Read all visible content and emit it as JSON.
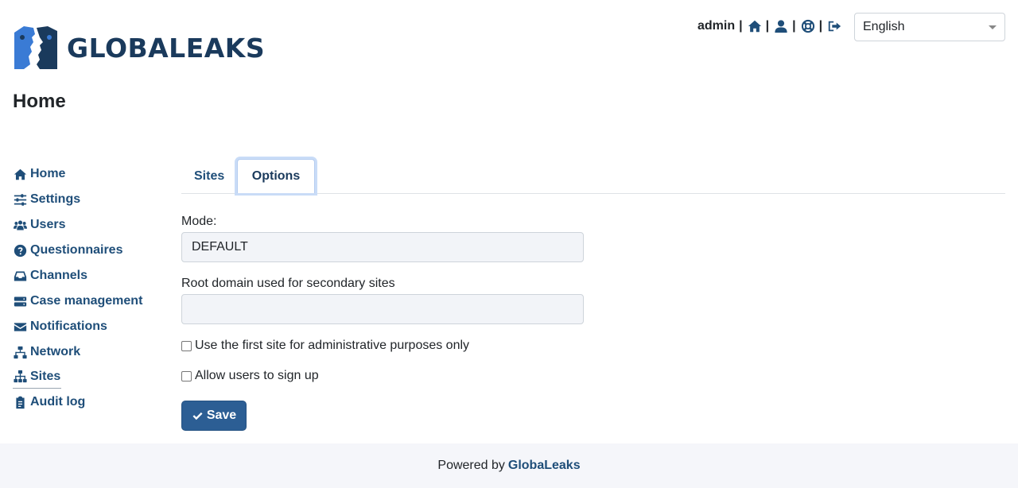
{
  "header": {
    "brand": "GLOBALEAKS",
    "username": "admin",
    "separator": "|",
    "icons": [
      "home-icon",
      "user-icon",
      "lifebuoy-icon",
      "logout-icon"
    ],
    "language": "English"
  },
  "page": {
    "title": "Home"
  },
  "sidebar": {
    "items": [
      {
        "label": "Home",
        "icon": "home-icon"
      },
      {
        "label": "Settings",
        "icon": "sliders-icon"
      },
      {
        "label": "Users",
        "icon": "users-icon"
      },
      {
        "label": "Questionnaires",
        "icon": "question-circle-icon"
      },
      {
        "label": "Channels",
        "icon": "inbox-icon"
      },
      {
        "label": "Case management",
        "icon": "server-icon"
      },
      {
        "label": "Notifications",
        "icon": "envelope-icon"
      },
      {
        "label": "Network",
        "icon": "network-icon"
      },
      {
        "label": "Sites",
        "icon": "sitemap-icon"
      },
      {
        "label": "Audit log",
        "icon": "clipboard-icon"
      }
    ],
    "active": "Sites"
  },
  "tabs": [
    {
      "label": "Sites",
      "active": false
    },
    {
      "label": "Options",
      "active": true
    }
  ],
  "form": {
    "mode_label": "Mode:",
    "mode_value": "DEFAULT",
    "root_domain_label": "Root domain used for secondary sites",
    "root_domain_value": "",
    "checkbox_admin_label": "Use the first site for administrative purposes only",
    "checkbox_admin_checked": false,
    "checkbox_signup_label": "Allow users to sign up",
    "checkbox_signup_checked": false,
    "save_label": "Save"
  },
  "footer": {
    "prefix": "Powered by",
    "brand": "GlobaLeaks"
  },
  "colors": {
    "primary": "#1f4e79",
    "button": "#2c5e94",
    "footer_bg": "#f5f6fa",
    "field_bg": "#f2f4f8"
  }
}
